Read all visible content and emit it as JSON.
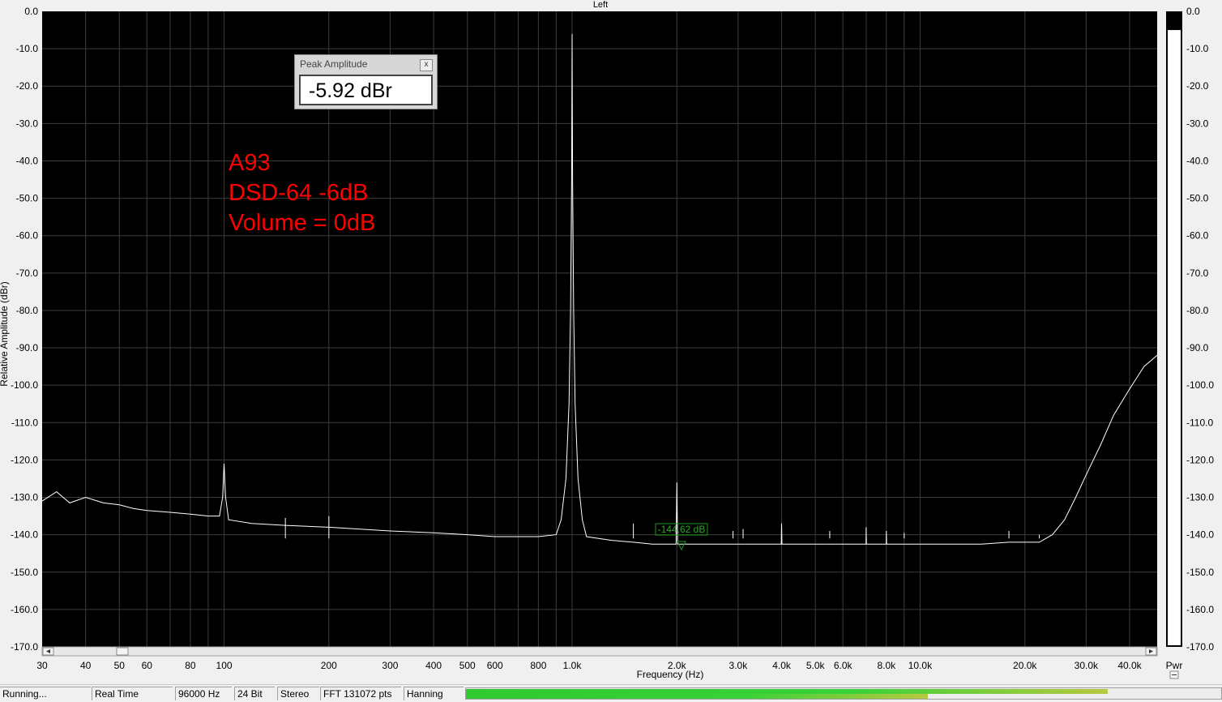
{
  "window": {
    "title": "Left",
    "pwr_label": "Pwr"
  },
  "peak_window": {
    "title": "Peak Amplitude",
    "close_glyph": "x",
    "value": "-5.92 dBr"
  },
  "annotation": {
    "line1": "A93",
    "line2": "DSD-64 -6dB",
    "line3": "Volume = 0dB"
  },
  "marker": {
    "label": "-144.62 dB",
    "freq": 2000,
    "db": -144.6
  },
  "status": {
    "state": "Running...",
    "mode": "Real Time",
    "rate": "96000 Hz",
    "bits": "24 Bit",
    "channels": "Stereo",
    "fft": "FFT 131072 pts",
    "window_fn": "Hanning",
    "meter_level": 0.85
  },
  "meter": {
    "ticks": [
      "0.0",
      "-10.0",
      "-20.0",
      "-30.0",
      "-40.0",
      "-50.0",
      "-60.0",
      "-70.0",
      "-80.0",
      "-90.0",
      "-100.0",
      "-110.0",
      "-120.0",
      "-130.0",
      "-140.0",
      "-150.0",
      "-160.0",
      "-170.0"
    ],
    "level": -5
  },
  "chart_data": {
    "type": "line",
    "title": "Left",
    "xlabel": "Frequency (Hz)",
    "ylabel": "Relative Amplitude (dBr)",
    "xscale": "log",
    "xlim": [
      30,
      48000
    ],
    "ylim": [
      -170,
      0
    ],
    "grid": true,
    "colors": {
      "background": "#000000",
      "trace": "#ffffff",
      "grid": "#3c3c3c",
      "marker": "#1e9a1e"
    },
    "yticks": [
      "0.0",
      "-10.0",
      "-20.0",
      "-30.0",
      "-40.0",
      "-50.0",
      "-60.0",
      "-70.0",
      "-80.0",
      "-90.0",
      "-100.0",
      "-110.0",
      "-120.0",
      "-130.0",
      "-140.0",
      "-150.0",
      "-160.0",
      "-170.0"
    ],
    "xticks": [
      {
        "v": 30,
        "label": "30"
      },
      {
        "v": 40,
        "label": "40"
      },
      {
        "v": 50,
        "label": "50"
      },
      {
        "v": 60,
        "label": "60"
      },
      {
        "v": 80,
        "label": "80"
      },
      {
        "v": 100,
        "label": "100"
      },
      {
        "v": 200,
        "label": "200"
      },
      {
        "v": 300,
        "label": "300"
      },
      {
        "v": 400,
        "label": "400"
      },
      {
        "v": 500,
        "label": "500"
      },
      {
        "v": 600,
        "label": "600"
      },
      {
        "v": 800,
        "label": "800"
      },
      {
        "v": 1000,
        "label": "1.0k"
      },
      {
        "v": 2000,
        "label": "2.0k"
      },
      {
        "v": 3000,
        "label": "3.0k"
      },
      {
        "v": 4000,
        "label": "4.0k"
      },
      {
        "v": 5000,
        "label": "5.0k"
      },
      {
        "v": 6000,
        "label": "6.0k"
      },
      {
        "v": 8000,
        "label": "8.0k"
      },
      {
        "v": 10000,
        "label": "10.0k"
      },
      {
        "v": 20000,
        "label": "20.0k"
      },
      {
        "v": 30000,
        "label": "30.0k"
      },
      {
        "v": 40000,
        "label": "40.0k"
      }
    ],
    "series": [
      {
        "points": [
          [
            30,
            -131
          ],
          [
            33,
            -128.5
          ],
          [
            36,
            -131.5
          ],
          [
            40,
            -130
          ],
          [
            45,
            -131.5
          ],
          [
            50,
            -132
          ],
          [
            55,
            -133
          ],
          [
            60,
            -133.5
          ],
          [
            70,
            -134
          ],
          [
            80,
            -134.5
          ],
          [
            90,
            -135
          ],
          [
            97,
            -135
          ],
          [
            99,
            -130
          ],
          [
            100,
            -121
          ],
          [
            101,
            -130
          ],
          [
            103,
            -136
          ],
          [
            120,
            -137
          ],
          [
            150,
            -137.5
          ],
          [
            200,
            -138
          ],
          [
            300,
            -139
          ],
          [
            400,
            -139.5
          ],
          [
            500,
            -140
          ],
          [
            600,
            -140.5
          ],
          [
            800,
            -140.5
          ],
          [
            900,
            -140
          ],
          [
            930,
            -136
          ],
          [
            960,
            -125
          ],
          [
            980,
            -105
          ],
          [
            990,
            -80
          ],
          [
            997,
            -45
          ],
          [
            1000,
            -6
          ],
          [
            1003,
            -45
          ],
          [
            1010,
            -80
          ],
          [
            1020,
            -105
          ],
          [
            1040,
            -125
          ],
          [
            1070,
            -136
          ],
          [
            1100,
            -140.5
          ],
          [
            1300,
            -141.5
          ],
          [
            1500,
            -142
          ],
          [
            1700,
            -142.5
          ],
          [
            1990,
            -142.5
          ],
          [
            2000,
            -126
          ],
          [
            2010,
            -142.5
          ],
          [
            2500,
            -142.5
          ],
          [
            3000,
            -142.5
          ],
          [
            3990,
            -142.5
          ],
          [
            4000,
            -137
          ],
          [
            4010,
            -142.5
          ],
          [
            5000,
            -142.5
          ],
          [
            6000,
            -142.5
          ],
          [
            6990,
            -142.5
          ],
          [
            7000,
            -138
          ],
          [
            7010,
            -142.5
          ],
          [
            7990,
            -142.5
          ],
          [
            8000,
            -139
          ],
          [
            8010,
            -142.5
          ],
          [
            10000,
            -142.5
          ],
          [
            15000,
            -142.5
          ],
          [
            18000,
            -142
          ],
          [
            22000,
            -142
          ],
          [
            24000,
            -140
          ],
          [
            26000,
            -136
          ],
          [
            28000,
            -130
          ],
          [
            30000,
            -124
          ],
          [
            33000,
            -116
          ],
          [
            36000,
            -108
          ],
          [
            40000,
            -101
          ],
          [
            44000,
            -95
          ],
          [
            48000,
            -92
          ]
        ],
        "spikes": [
          [
            150,
            -135.5
          ],
          [
            200,
            -135
          ],
          [
            1500,
            -137
          ],
          [
            2900,
            -139
          ],
          [
            3100,
            -138.5
          ],
          [
            5500,
            -139
          ],
          [
            9000,
            -139.5
          ],
          [
            18000,
            -139
          ],
          [
            22000,
            -140
          ]
        ]
      }
    ]
  }
}
